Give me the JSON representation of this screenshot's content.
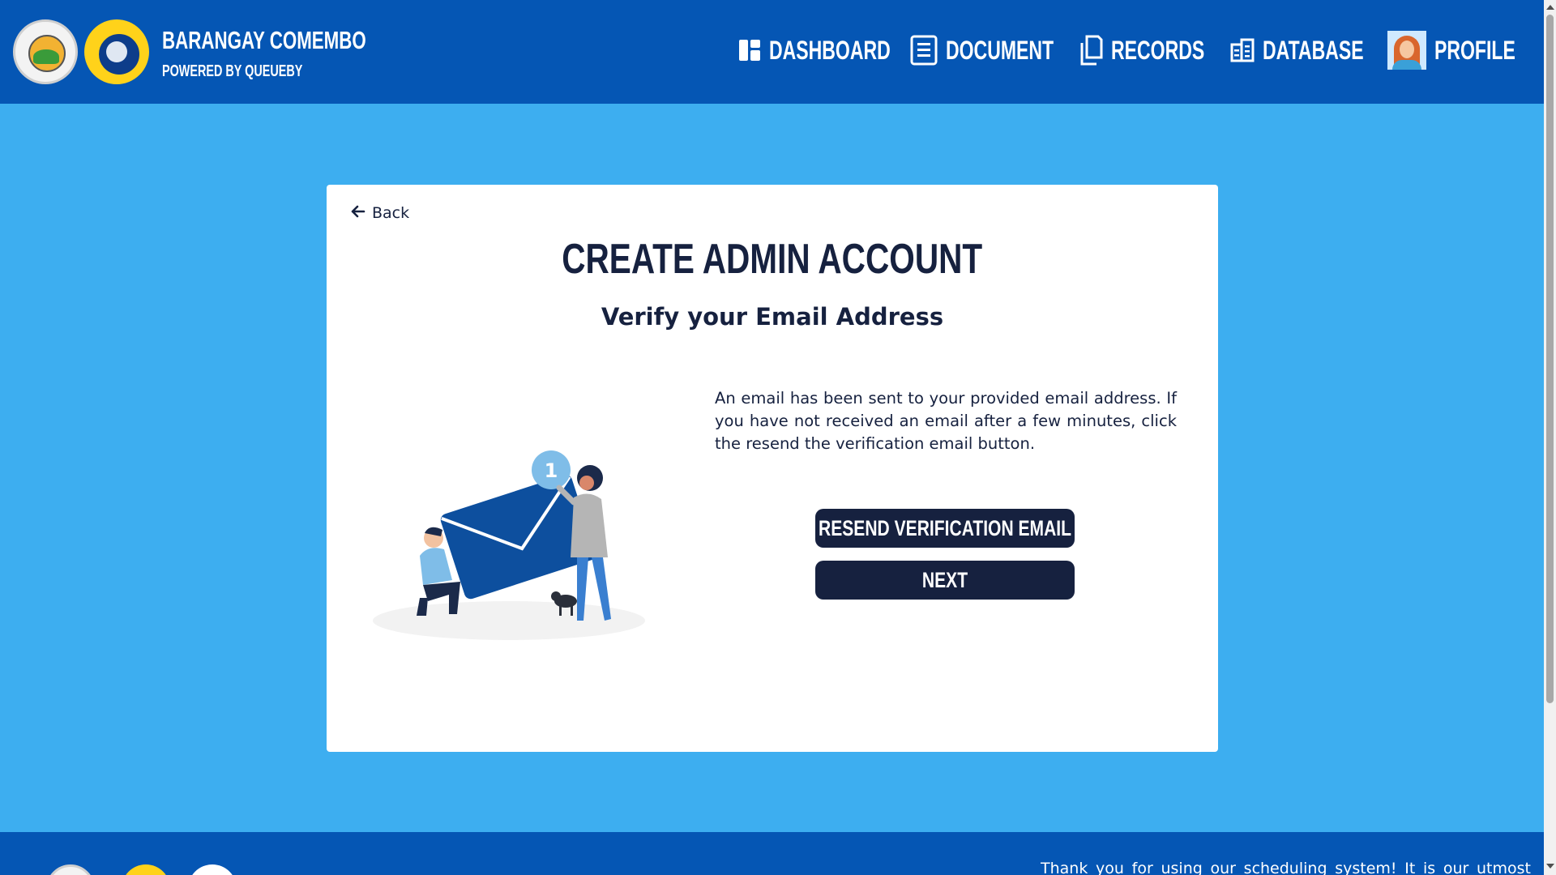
{
  "header": {
    "brand_title": "BARANGAY COMEMBO",
    "brand_subtitle": "POWERED BY QUEUEBY",
    "nav": {
      "dashboard": "DASHBOARD",
      "document": "DOCUMENT",
      "records": "RECORDS",
      "database": "DATABASE",
      "profile": "PROFILE"
    }
  },
  "card": {
    "back_label": "Back",
    "title": "CREATE ADMIN ACCOUNT",
    "subtitle": "Verify your Email Address",
    "description": "An email has been sent to your provided email address. If you have not received an email after a few minutes, click the resend the verification email button.",
    "resend_button": "RESEND VERIFICATION EMAIL",
    "next_button": "NEXT",
    "badge_count": "1"
  },
  "footer": {
    "text": "Thank you for using our scheduling system! It is our utmost"
  },
  "colors": {
    "header_bg": "#0556b4",
    "page_bg": "#3daef0",
    "button_bg": "#16213f",
    "text_dark": "#16213f"
  }
}
